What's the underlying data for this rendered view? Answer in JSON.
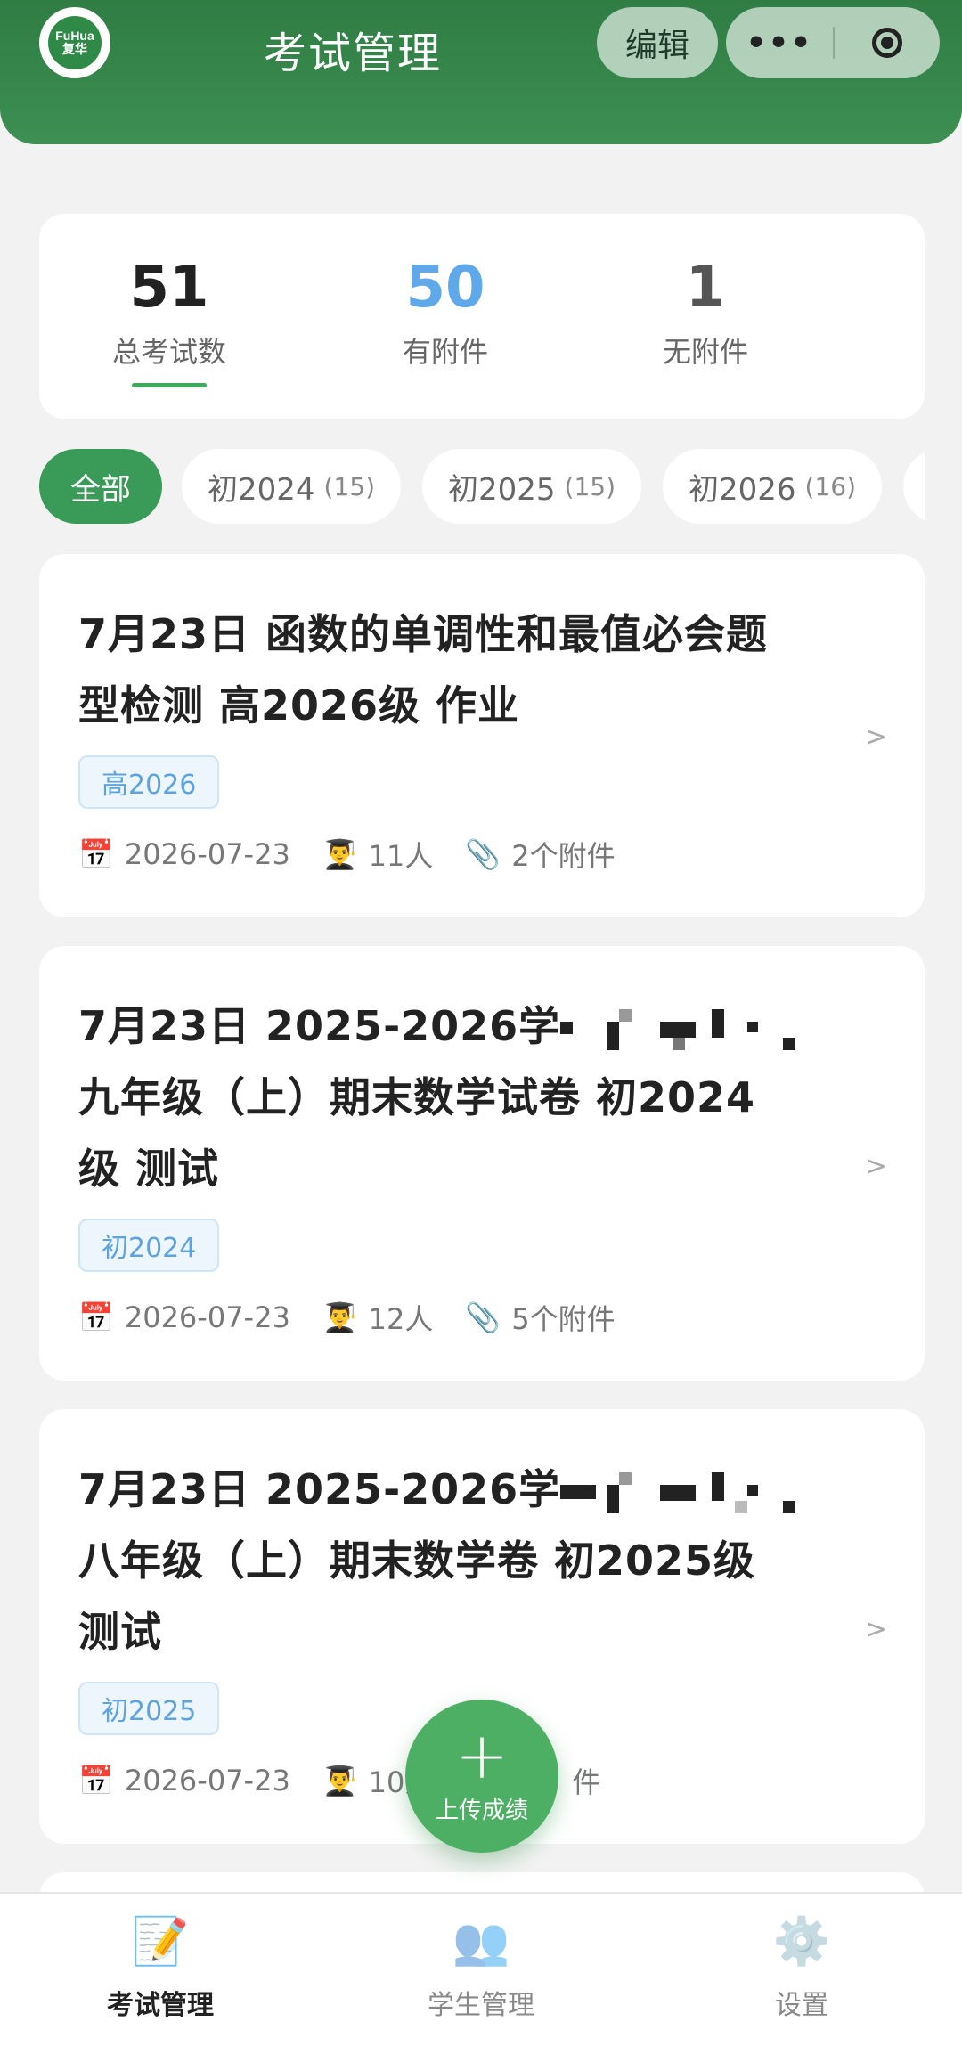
{
  "header": {
    "title": "考试管理",
    "edit_label": "编辑",
    "more_label": "•••",
    "logo_text_top": "FuHua",
    "logo_text_bottom": "复华"
  },
  "stats": {
    "total": {
      "value": "51",
      "label": "总考试数"
    },
    "with_attachments": {
      "value": "50",
      "label": "有附件",
      "color": "#5fa8ea"
    },
    "without_attachments": {
      "value": "1",
      "label": "无附件"
    }
  },
  "filters": [
    {
      "label": "全部",
      "count": ""
    },
    {
      "label": "初2024",
      "count": "(15)"
    },
    {
      "label": "初2025",
      "count": "(15)"
    },
    {
      "label": "初2026",
      "count": "(16)"
    }
  ],
  "exams": [
    {
      "title_line1": "7月23日 函数的单调性和最值必会题",
      "title_line2": "型检测 高2026级 作业",
      "tag": "高2026",
      "date": "2026-07-23",
      "students": "11人",
      "attachments": "2个附件"
    },
    {
      "title_line1": "7月23日 2025-2026学",
      "title_line2": "九年级（上）期末数学试卷 初2024",
      "title_line3": "级 测试",
      "tag": "初2024",
      "date": "2026-07-23",
      "students": "12人",
      "attachments": "5个附件"
    },
    {
      "title_line1": "7月23日 2025-2026学",
      "title_line2": "八年级（上）期末数学卷 初2025级",
      "title_line3": "测试",
      "tag": "初2025",
      "date": "2026-07-23",
      "students": "10人",
      "attachments": "件"
    }
  ],
  "fab": {
    "label": "上传成绩",
    "icon": "plus"
  },
  "tabbar": [
    {
      "label": "考试管理",
      "icon": "memo-icon"
    },
    {
      "label": "学生管理",
      "icon": "people-icon"
    },
    {
      "label": "设置",
      "icon": "gear-icon"
    }
  ],
  "icons": {
    "calendar": "📅",
    "student": "👨‍🎓",
    "paperclip": "📎",
    "chevron": ">"
  }
}
